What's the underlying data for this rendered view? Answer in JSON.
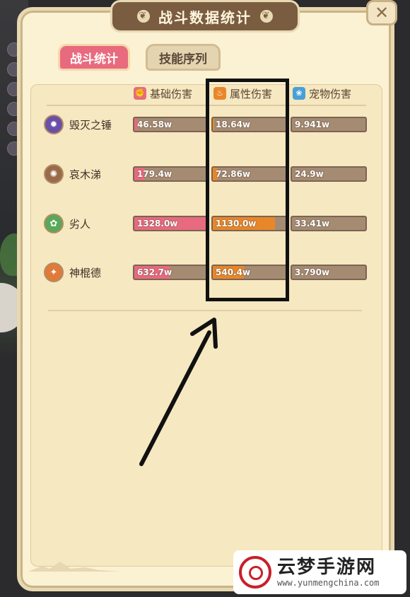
{
  "window": {
    "title": "战斗数据统计",
    "close_label": "✕"
  },
  "tabs": [
    {
      "label": "战斗统计",
      "active": true
    },
    {
      "label": "技能序列",
      "active": false
    }
  ],
  "columns": [
    {
      "label": "基础伤害",
      "icon": "fist-icon",
      "color": "#e86a7e"
    },
    {
      "label": "属性伤害",
      "icon": "flame-icon",
      "color": "#e8872a"
    },
    {
      "label": "宠物伤害",
      "icon": "paw-icon",
      "color": "#4aa0d6"
    }
  ],
  "rows": [
    {
      "name": "毁灭之锤",
      "icon": "hammer-skill-icon",
      "icon_color": "#6a4fa8",
      "base": {
        "value": "46.58w",
        "level": 0.035
      },
      "element": {
        "value": "18.64w",
        "level": 0.016
      },
      "pet": {
        "value": "9.941w",
        "level": 0.0
      }
    },
    {
      "name": "哀木涕",
      "icon": "tree-skill-icon",
      "icon_color": "#9a6a4a",
      "base": {
        "value": "179.4w",
        "level": 0.135
      },
      "element": {
        "value": "72.86w",
        "level": 0.064
      },
      "pet": {
        "value": "24.9w",
        "level": 0.0
      }
    },
    {
      "name": "劣人",
      "icon": "vine-skill-icon",
      "icon_color": "#5aa85a",
      "base": {
        "value": "1328.0w",
        "level": 1.0
      },
      "element": {
        "value": "1130.0w",
        "level": 0.85
      },
      "pet": {
        "value": "33.41w",
        "level": 0.0
      }
    },
    {
      "name": "神棍德",
      "icon": "claw-skill-icon",
      "icon_color": "#e07a3a",
      "base": {
        "value": "632.7w",
        "level": 0.48
      },
      "element": {
        "value": "540.4w",
        "level": 0.42
      },
      "pet": {
        "value": "3.790w",
        "level": 0.0
      }
    }
  ],
  "bar_bg_color": "#a48b72",
  "watermark": {
    "title": "云梦手游网",
    "url": "www.yunmengchina.com"
  }
}
